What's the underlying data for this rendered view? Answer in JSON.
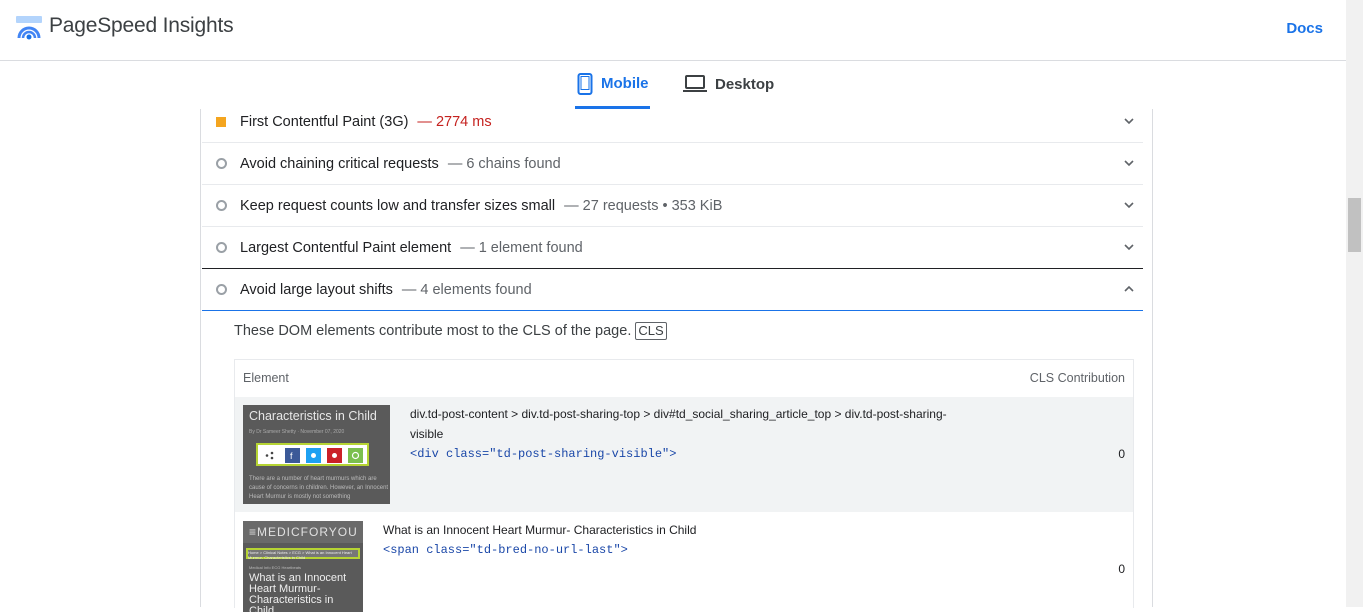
{
  "header": {
    "app_title": "PageSpeed Insights",
    "docs_label": "Docs"
  },
  "tabs": [
    {
      "label": "Mobile",
      "active": true,
      "icon": "smartphone-icon"
    },
    {
      "label": "Desktop",
      "active": false,
      "icon": "laptop-icon"
    }
  ],
  "audits": [
    {
      "title": "First Contentful Paint (3G)",
      "detail": "— 2774 ms",
      "status": "average",
      "expanded": false
    },
    {
      "title": "Avoid chaining critical requests",
      "detail": "— 6 chains found",
      "status": "informative",
      "expanded": false
    },
    {
      "title": "Keep request counts low and transfer sizes small",
      "detail": "— 27 requests • 353 KiB",
      "status": "informative",
      "expanded": false
    },
    {
      "title": "Largest Contentful Paint element",
      "detail": "— 1 element found",
      "status": "informative",
      "expanded": false
    },
    {
      "title": "Avoid large layout shifts",
      "detail": "— 4 elements found",
      "status": "informative",
      "expanded": true
    }
  ],
  "expanded_audit": {
    "description": "These DOM elements contribute most to the CLS of the page.",
    "badge": "CLS",
    "table": {
      "col_element": "Element",
      "col_cls": "CLS Contribution",
      "rows": [
        {
          "selector": "div.td-post-content > div.td-post-sharing-top > div#td_social_sharing_article_top > div.td-post-sharing-visible",
          "snippet": "<div class=\"td-post-sharing-visible\">",
          "cls": "0",
          "thumb_heading": "Characteristics in Child",
          "thumb_meta": "By Dr Sameer Shetty · November 07, 2020",
          "thumb_text": "There are a number of heart murmurs which are cause of concerns in children. However, an Innocent Heart Murmur is mostly not something"
        },
        {
          "selector": "What is an Innocent Heart Murmur- Characteristics in Child",
          "snippet": "<span class=\"td-bred-no-url-last\">",
          "cls": "0",
          "thumb_brand": "≡MEDICFORYOU",
          "thumb_breadcrumb": "Home > Clinical Notes > ECG > What is an Innocent Heart Murmur- Characteristics in Child",
          "thumb_tags": "Medical Info    ECG    Heartbeats",
          "thumb_title": "What is an Innocent Heart Murmur- Characteristics in Child"
        }
      ]
    }
  },
  "colors": {
    "accent": "#1a73e8",
    "average": "#f4a51f",
    "warn_text": "#c5221f",
    "highlight": "#b6d433"
  }
}
